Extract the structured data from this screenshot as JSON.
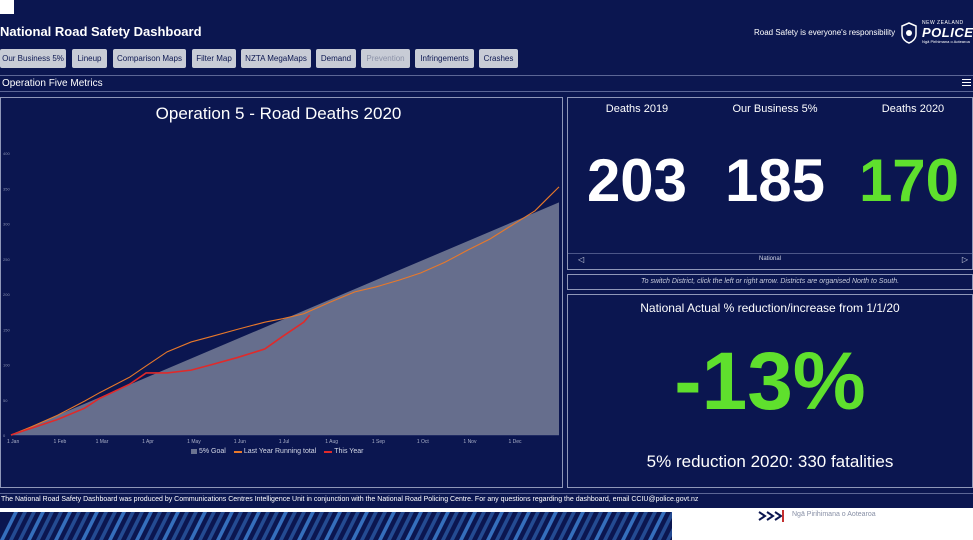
{
  "app": {
    "title": "National Road Safety Dashboard",
    "tagline": "Road Safety is everyone's responsibility",
    "logo": {
      "top": "NEW ZEALAND",
      "word": "POLICE",
      "sub": "Ngā Pirihimana o Aotearoa"
    }
  },
  "nav": {
    "tabs": [
      {
        "label": "Our Business 5%",
        "disabled": false
      },
      {
        "label": "Lineup",
        "disabled": false
      },
      {
        "label": "Comparison Maps",
        "disabled": false
      },
      {
        "label": "Filter Map",
        "disabled": false
      },
      {
        "label": "NZTA MegaMaps",
        "disabled": false
      },
      {
        "label": "Demand",
        "disabled": false
      },
      {
        "label": "Prevention",
        "disabled": true
      },
      {
        "label": "Infringements",
        "disabled": false
      },
      {
        "label": "Crashes",
        "disabled": false
      }
    ]
  },
  "section": {
    "title": "Operation Five Metrics"
  },
  "chart_data": {
    "type": "line",
    "title": "Operation 5 - Road Deaths 2020",
    "xlabel": "",
    "ylabel": "",
    "x_ticks": [
      "1 Jan",
      "1 Feb",
      "1 Mar",
      "1 Apr",
      "1 May",
      "1 Jun",
      "1 Jul",
      "1 Aug",
      "1 Sep",
      "1 Oct",
      "1 Nov",
      "1 Dec"
    ],
    "y_ticks": [
      "0",
      "50",
      "100",
      "150",
      "200",
      "250",
      "300",
      "350",
      "400"
    ],
    "ylim": [
      0,
      400
    ],
    "x_unit": "day of year",
    "xlim": [
      1,
      366
    ],
    "legend_position": "bottom",
    "series": [
      {
        "name": "5% Goal",
        "kind": "area",
        "color": "#6b7390",
        "x": [
          1,
          366
        ],
        "y": [
          0,
          330
        ]
      },
      {
        "name": "Last Year Running total",
        "kind": "line",
        "color": "#e8782a",
        "x": [
          1,
          15,
          32,
          50,
          60,
          80,
          91,
          105,
          121,
          135,
          152,
          170,
          182,
          196,
          213,
          230,
          244,
          260,
          274,
          290,
          305,
          320,
          335,
          350,
          358,
          366
        ],
        "y": [
          0,
          12,
          28,
          48,
          60,
          82,
          98,
          118,
          132,
          140,
          150,
          160,
          165,
          172,
          188,
          203,
          210,
          220,
          230,
          245,
          262,
          278,
          298,
          318,
          335,
          352
        ]
      },
      {
        "name": "This Year",
        "kind": "line",
        "color": "#e02a2a",
        "x": [
          1,
          15,
          32,
          50,
          60,
          80,
          91,
          105,
          121,
          135,
          152,
          170,
          182,
          196,
          200
        ],
        "y": [
          0,
          10,
          22,
          38,
          52,
          72,
          88,
          88,
          92,
          100,
          110,
          122,
          140,
          160,
          170
        ]
      }
    ]
  },
  "stats": {
    "deaths_2019": {
      "label": "Deaths 2019",
      "value": "203",
      "color": "#ffffff"
    },
    "our_business": {
      "label": "Our Business 5%",
      "value": "185",
      "color": "#ffffff"
    },
    "deaths_2020": {
      "label": "Deaths 2020",
      "value": "170",
      "color": "#5fe02d"
    },
    "district": "National",
    "arrow_left": "◁",
    "arrow_right": "▷"
  },
  "hint": {
    "text": "To switch District, click the left or right arrow. Districts are organised North to South."
  },
  "reduction": {
    "title": "National Actual % reduction/increase from 1/1/20",
    "value": "-13%",
    "goal": "5% reduction 2020: 330 fatalities"
  },
  "footer": {
    "note": "The National Road Safety Dashboard was produced by Communications Centres Intelligence Unit in conjunction with the National Road Policing Centre. For any questions regarding the dashboard, email CCIU@police.govt.nz"
  },
  "bottom": {
    "caption": "Ngā Pirihimana o Aotearoa"
  }
}
